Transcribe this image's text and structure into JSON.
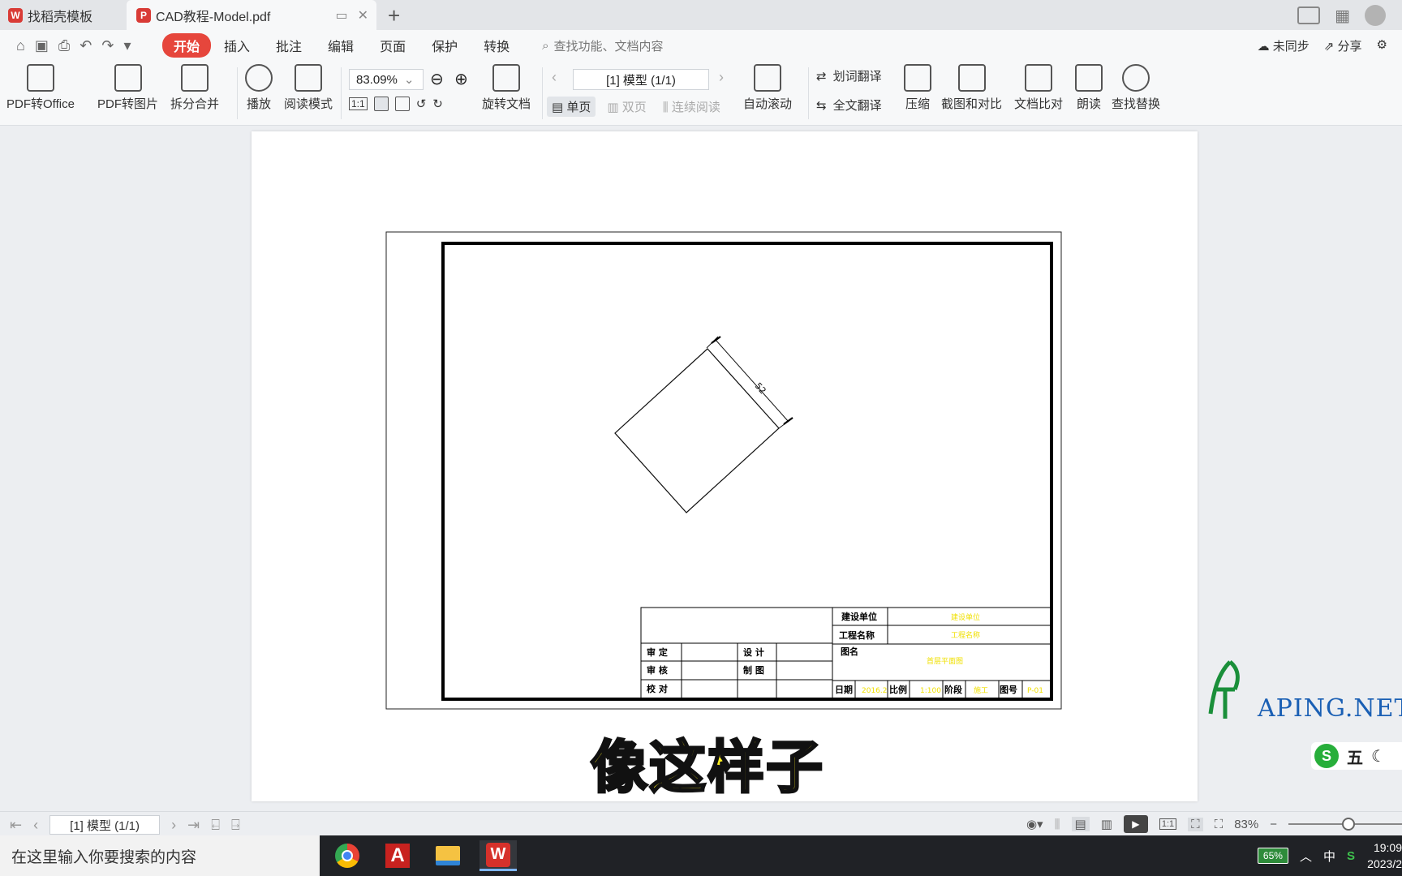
{
  "tabs": [
    {
      "label": "找稻壳模板",
      "active": false
    },
    {
      "label": "CAD教程-Model.pdf",
      "active": true
    }
  ],
  "menu": {
    "items": [
      "开始",
      "插入",
      "批注",
      "编辑",
      "页面",
      "保护",
      "转换"
    ],
    "active_index": 0,
    "search_placeholder": "查找功能、文档内容",
    "sync_label": "未同步",
    "share_label": "分享"
  },
  "ribbon": {
    "pdf_to_office": "PDF转Office",
    "pdf_to_image": "PDF转图片",
    "split_merge": "拆分合并",
    "play": "播放",
    "read_mode": "阅读模式",
    "zoom_value": "83.09%",
    "rotate_doc": "旋转文档",
    "page_indicator": "[1] 模型 (1/1)",
    "single_page": "单页",
    "double_page": "双页",
    "continuous": "连续阅读",
    "auto_scroll": "自动滚动",
    "word_translate": "划词翻译",
    "full_translate": "全文翻译",
    "compress": "压缩",
    "screenshot_compare": "截图和对比",
    "doc_compare": "文档比对",
    "read_aloud": "朗读",
    "find_replace": "查找替换",
    "one_to_one": "1:1"
  },
  "drawing": {
    "dimension": "52",
    "title_block": {
      "approve": "审  定",
      "review": "审  核",
      "check": "校  对",
      "design": "设  计",
      "draw": "制  图",
      "unit_label": "建设单位",
      "unit_value": "建设单位",
      "project_label": "工程名称",
      "project_value": "工程名称",
      "drawing_name_label": "图名",
      "drawing_name_value": "首层平面图",
      "date_label": "日期",
      "date_value": "2016.2",
      "scale_label": "比例",
      "scale_value": "1:100",
      "stage_label": "阶段",
      "stage_value": "施工",
      "number_label": "图号",
      "number_value": "P-01"
    }
  },
  "subtitle": "像这样子",
  "watermark": {
    "text": "APING.NET"
  },
  "ime": {
    "label": "五"
  },
  "statusbar": {
    "page_indicator": "[1] 模型 (1/1)",
    "zoom": "83%",
    "one_to_one": "1:1"
  },
  "taskbar": {
    "search_placeholder": "在这里输入你要搜索的内容",
    "battery": "65%",
    "ime_lang": "中",
    "time": "19:09",
    "date": "2023/2"
  },
  "colors": {
    "accent": "#e6463c",
    "subtitle_fill": "#fff021",
    "watermark": "#1a5fb4",
    "titleblock_value": "#f0e000"
  }
}
